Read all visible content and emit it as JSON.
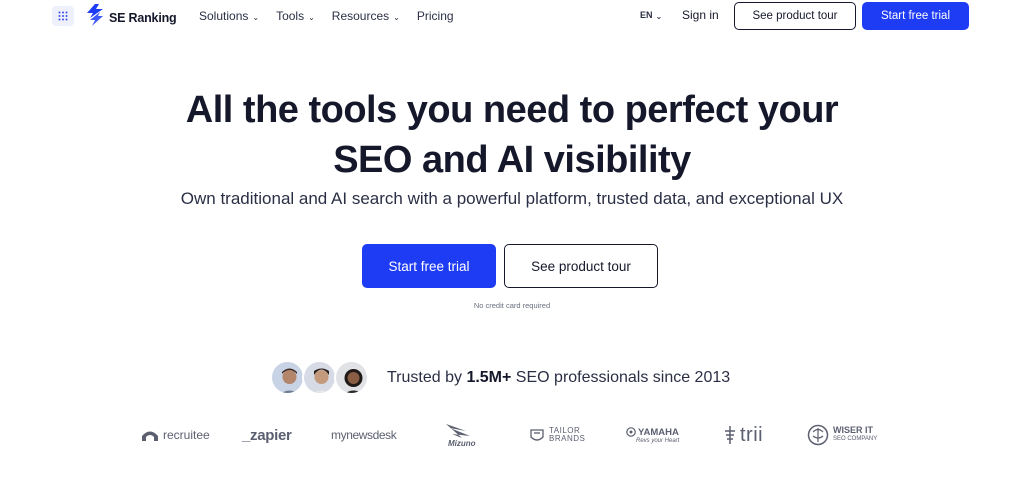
{
  "nav": {
    "logo_text": "SE Ranking",
    "menu": [
      {
        "label": "Solutions",
        "has_dropdown": true
      },
      {
        "label": "Tools",
        "has_dropdown": true
      },
      {
        "label": "Resources",
        "has_dropdown": true
      },
      {
        "label": "Pricing",
        "has_dropdown": false
      }
    ],
    "language": "EN",
    "sign_in": "Sign in",
    "product_tour": "See product tour",
    "free_trial": "Start free trial"
  },
  "hero": {
    "title_line1": "All the tools you need to perfect your",
    "title_line2": "SEO and AI visibility",
    "subtitle": "Own traditional and AI search with a powerful platform, trusted data, and exceptional UX",
    "cta_primary": "Start free trial",
    "cta_secondary": "See product tour",
    "note": "No credit card required"
  },
  "trust": {
    "prefix": "Trusted by ",
    "highlight": "1.5M+",
    "suffix": " SEO professionals since 2013"
  },
  "logos": {
    "recruitee": "recruitee",
    "zapier": "_zapier",
    "mynewsdesk": "mynewsdesk",
    "mizuno": "Mizuno",
    "tailor_line1": "TAILOR",
    "tailor_line2": "BRANDS",
    "yamaha": "YAMAHA",
    "yamaha_tagline": "Revs your Heart",
    "trii": "trii",
    "wiser_line1": "WISER IT",
    "wiser_line2": "SEO COMPANY"
  },
  "colors": {
    "brand_blue": "#1f3cf5",
    "text_dark": "#15182b",
    "logo_gray": "#5b5f70"
  },
  "icons": [
    "apps-grid-icon",
    "se-ranking-logo-icon",
    "chevron-down-icon"
  ]
}
